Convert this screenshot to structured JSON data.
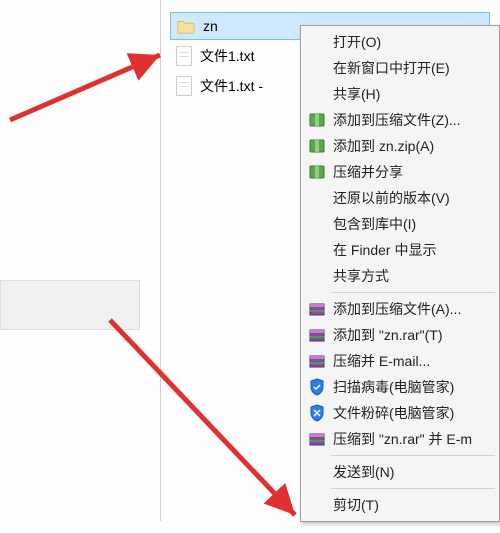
{
  "files": {
    "folder": "zn",
    "file1": "文件1.txt",
    "file2": "文件1.txt -"
  },
  "menu": {
    "open": "打开(O)",
    "open_new_window": "在新窗口中打开(E)",
    "share_h": "共享(H)",
    "add_to_archive": "添加到压缩文件(Z)...",
    "add_to_named_zip": "添加到 zn.zip(A)",
    "compress_share": "压缩并分享",
    "restore_previous": "还原以前的版本(V)",
    "include_library": "包含到库中(I)",
    "show_in_finder": "在 Finder 中显示",
    "share_methods": "共享方式",
    "rar_add": "添加到压缩文件(A)...",
    "rar_add_named": "添加到 \"zn.rar\"(T)",
    "rar_email": "压缩并 E-mail...",
    "scan_virus": "扫描病毒(电脑管家)",
    "file_shred": "文件粉碎(电脑管家)",
    "rar_email_named": "压缩到 \"zn.rar\" 并 E-m",
    "send_to": "发送到(N)",
    "cut": "剪切(T)"
  }
}
